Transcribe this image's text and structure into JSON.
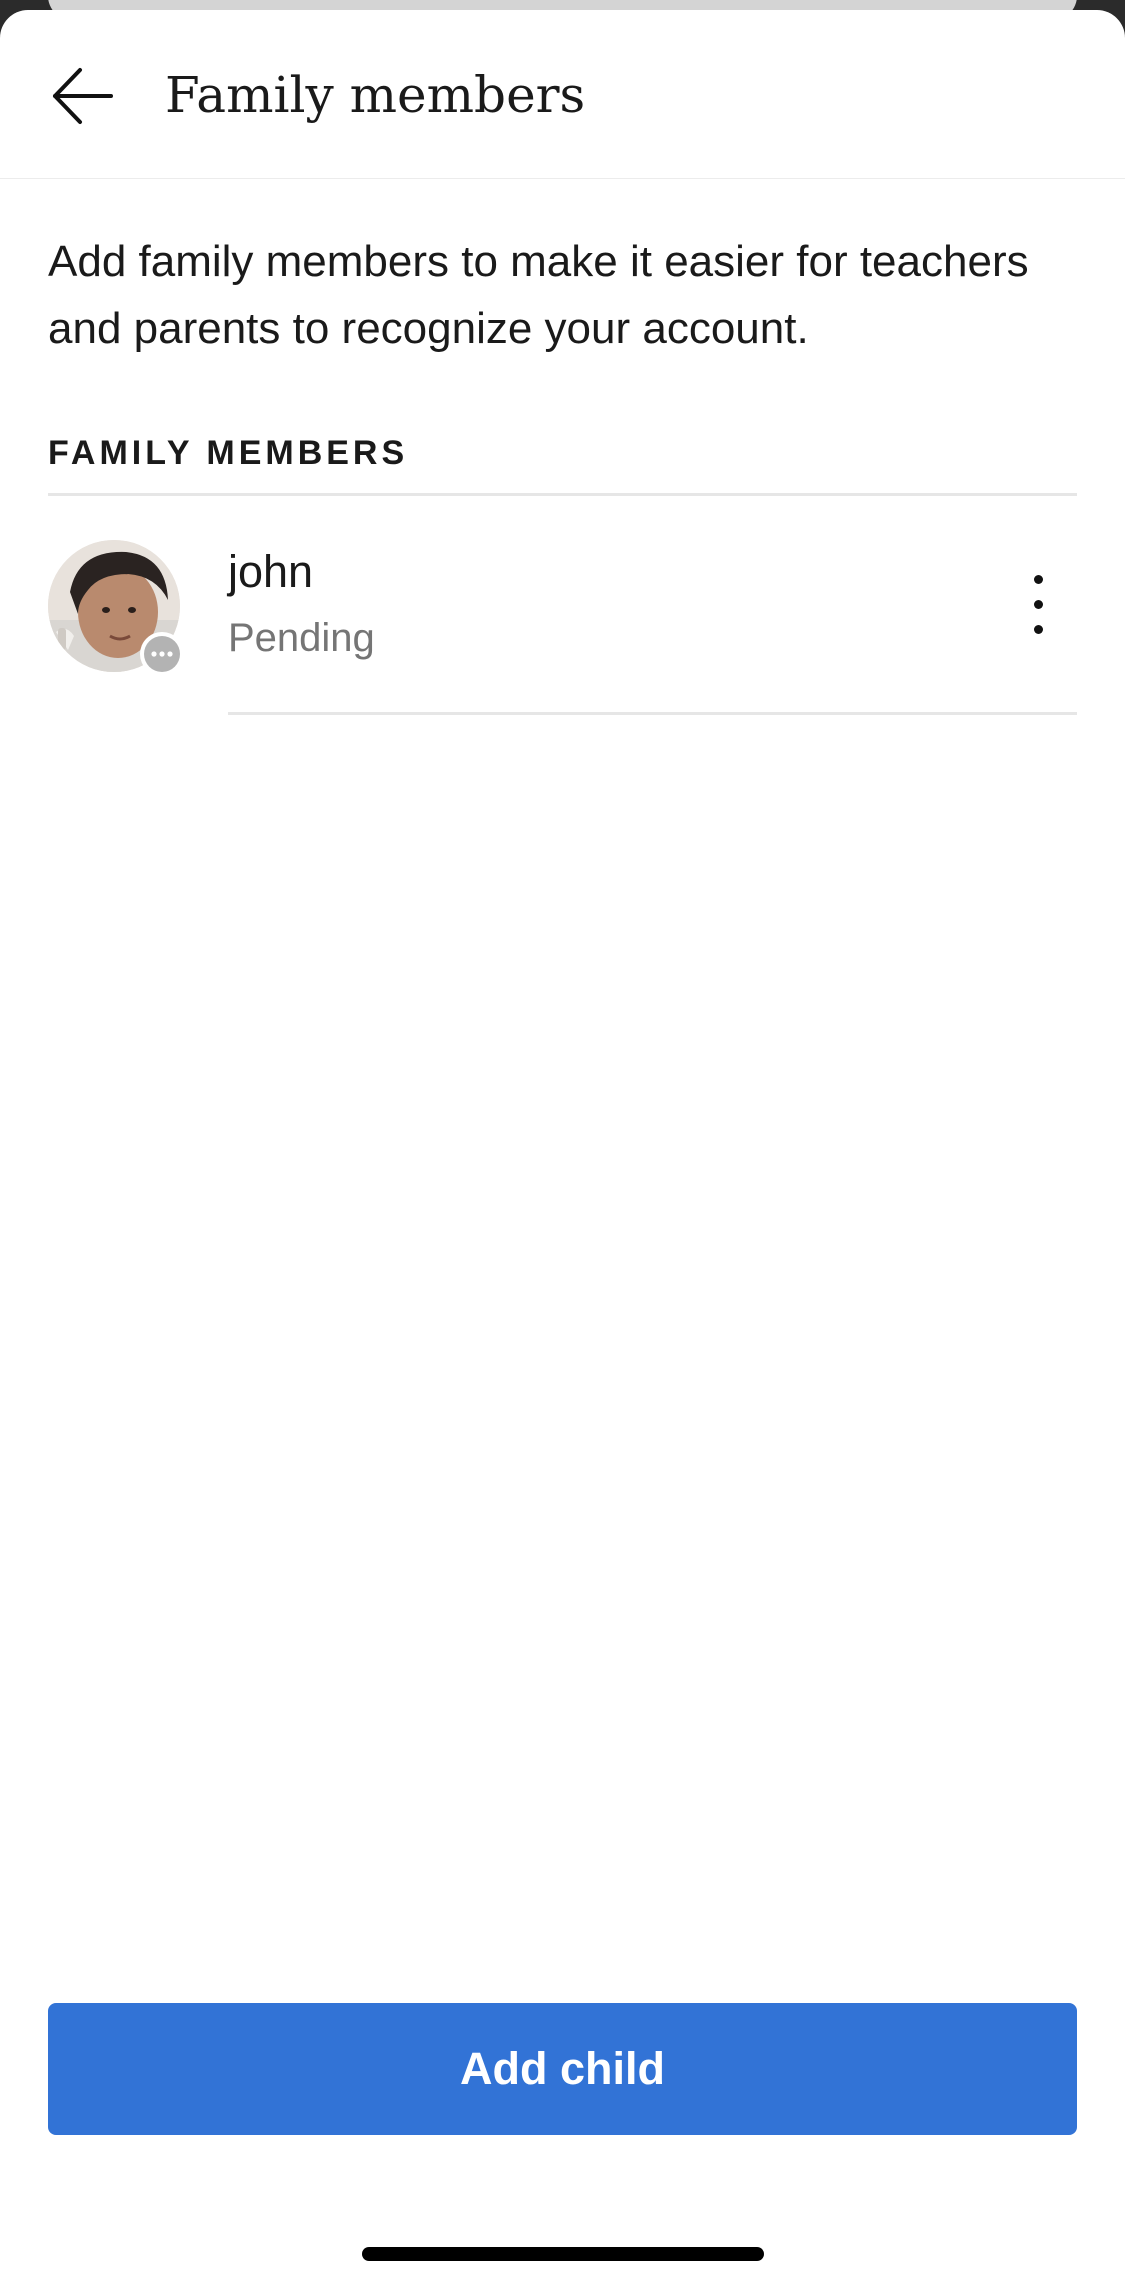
{
  "header": {
    "title": "Family members",
    "back_icon": "arrow-left-icon"
  },
  "description": "Add family members to make it easier for teachers and parents to recognize your account.",
  "section": {
    "label": "FAMILY MEMBERS"
  },
  "members": [
    {
      "name": "john",
      "status": "Pending",
      "status_icon": "ellipsis-icon",
      "menu_icon": "more-vertical-icon"
    }
  ],
  "actions": {
    "add_child_label": "Add child"
  },
  "colors": {
    "accent": "#3273d6",
    "text_primary": "#1a1a1a",
    "text_secondary": "#757575",
    "divider": "#e6e6e6",
    "status_gray": "#b3b3b3"
  }
}
